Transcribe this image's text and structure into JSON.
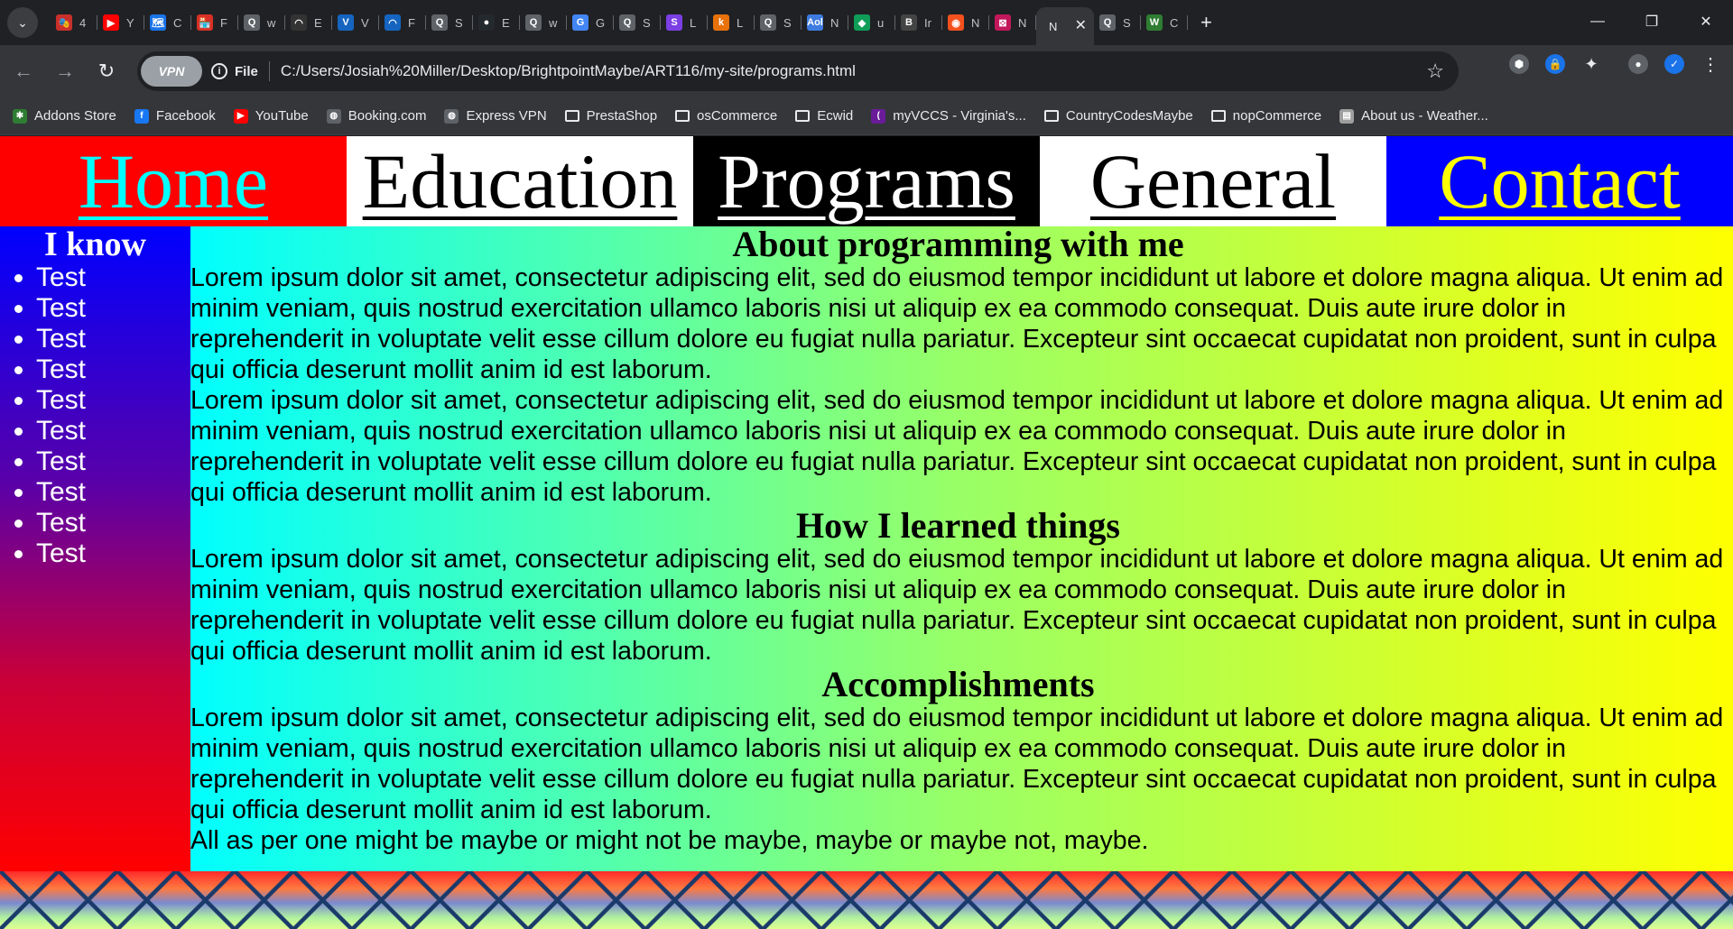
{
  "browser": {
    "tabs": [
      {
        "fav": "🎭",
        "title": "4",
        "color": "#c9302c"
      },
      {
        "fav": "▶",
        "title": "Y",
        "color": "#ff0000"
      },
      {
        "fav": "🗺",
        "title": "C",
        "color": "#1a73e8"
      },
      {
        "fav": "🏪",
        "title": "F",
        "color": "#d93025"
      },
      {
        "fav": "Q",
        "title": "w",
        "color": "#5f6368"
      },
      {
        "fav": "◠",
        "title": "E",
        "color": "#333333"
      },
      {
        "fav": "V",
        "title": "V",
        "color": "#1565c0"
      },
      {
        "fav": "◠",
        "title": "F",
        "color": "#1565c0"
      },
      {
        "fav": "Q",
        "title": "S",
        "color": "#5f6368"
      },
      {
        "fav": "●",
        "title": "E",
        "color": "#24292e"
      },
      {
        "fav": "Q",
        "title": "w",
        "color": "#5f6368"
      },
      {
        "fav": "G",
        "title": "G",
        "color": "#4285f4"
      },
      {
        "fav": "Q",
        "title": "S",
        "color": "#5f6368"
      },
      {
        "fav": "S",
        "title": "L",
        "color": "#7b3fe4"
      },
      {
        "fav": "k",
        "title": "L",
        "color": "#e8710a"
      },
      {
        "fav": "Q",
        "title": "S",
        "color": "#5f6368"
      },
      {
        "fav": "Aol",
        "title": "N",
        "color": "#3d7be0"
      },
      {
        "fav": "◆",
        "title": "u",
        "color": "#0f9d58"
      },
      {
        "fav": "B",
        "title": "Ir",
        "color": "#444444"
      },
      {
        "fav": "◉",
        "title": "N",
        "color": "#f4511e"
      },
      {
        "fav": "⊠",
        "title": "N",
        "color": "#c2185b"
      }
    ],
    "active_tab": {
      "title": "N",
      "close": "✕"
    },
    "after_tabs": [
      {
        "fav": "Q",
        "title": "S",
        "color": "#5f6368"
      },
      {
        "fav": "W",
        "title": "C",
        "color": "#2e7d32"
      }
    ],
    "new_tab": "+",
    "window_controls": {
      "minimize": "—",
      "restore": "❐",
      "close": "✕"
    },
    "nav": {
      "back": "←",
      "forward": "→",
      "reload": "↻"
    },
    "vpn_label": "VPN",
    "file_label": "File",
    "url": "C:/Users/Josiah%20Miller/Desktop/BrightpointMaybe/ART116/my-site/programs.html",
    "bookmarks": [
      {
        "label": "Addons Store",
        "icon": "puzzle",
        "color": "#2e7d32"
      },
      {
        "label": "Facebook",
        "icon": "f",
        "color": "#1877f2"
      },
      {
        "label": "YouTube",
        "icon": "▶",
        "color": "#ff0000"
      },
      {
        "label": "Booking.com",
        "icon": "globe",
        "color": "#5f6368"
      },
      {
        "label": "Express VPN",
        "icon": "globe",
        "color": "#5f6368"
      },
      {
        "label": "PrestaShop",
        "icon": "folder"
      },
      {
        "label": "osCommerce",
        "icon": "folder"
      },
      {
        "label": "Ecwid",
        "icon": "folder"
      },
      {
        "label": "myVCCS - Virginia's...",
        "icon": "(",
        "color": "#6a1b9a"
      },
      {
        "label": "CountryCodesMaybe",
        "icon": "folder"
      },
      {
        "label": "nopCommerce",
        "icon": "folder"
      },
      {
        "label": "About us - Weather...",
        "icon": "doc",
        "color": "#9e9e9e"
      }
    ]
  },
  "page": {
    "nav": {
      "home": "Home",
      "education": "Education",
      "programs": "Programs",
      "general": "General",
      "contact": "Contact"
    },
    "sidebar": {
      "heading": "I know",
      "items": [
        "Test",
        "Test",
        "Test",
        "Test",
        "Test",
        "Test",
        "Test",
        "Test",
        "Test",
        "Test"
      ]
    },
    "main": {
      "heading1": "About programming with me",
      "para1": "Lorem ipsum dolor sit amet, consectetur adipiscing elit, sed do eiusmod tempor incididunt ut labore et dolore magna aliqua. Ut enim ad minim veniam, quis nostrud exercitation ullamco laboris nisi ut aliquip ex ea commodo consequat. Duis aute irure dolor in reprehenderit in voluptate velit esse cillum dolore eu fugiat nulla pariatur. Excepteur sint occaecat cupidatat non proident, sunt in culpa qui officia deserunt mollit anim id est laborum.",
      "para2": "Lorem ipsum dolor sit amet, consectetur adipiscing elit, sed do eiusmod tempor incididunt ut labore et dolore magna aliqua. Ut enim ad minim veniam, quis nostrud exercitation ullamco laboris nisi ut aliquip ex ea commodo consequat. Duis aute irure dolor in reprehenderit in voluptate velit esse cillum dolore eu fugiat nulla pariatur. Excepteur sint occaecat cupidatat non proident, sunt in culpa qui officia deserunt mollit anim id est laborum.",
      "heading2": "How I learned things",
      "para3": "Lorem ipsum dolor sit amet, consectetur adipiscing elit, sed do eiusmod tempor incididunt ut labore et dolore magna aliqua. Ut enim ad minim veniam, quis nostrud exercitation ullamco laboris nisi ut aliquip ex ea commodo consequat. Duis aute irure dolor in reprehenderit in voluptate velit esse cillum dolore eu fugiat nulla pariatur. Excepteur sint occaecat cupidatat non proident, sunt in culpa qui officia deserunt mollit anim id est laborum.",
      "heading3": "Accomplishments",
      "para4": "Lorem ipsum dolor sit amet, consectetur adipiscing elit, sed do eiusmod tempor incididunt ut labore et dolore magna aliqua. Ut enim ad minim veniam, quis nostrud exercitation ullamco laboris nisi ut aliquip ex ea commodo consequat. Duis aute irure dolor in reprehenderit in voluptate velit esse cillum dolore eu fugiat nulla pariatur. Excepteur sint occaecat cupidatat non proident, sunt in culpa qui officia deserunt mollit anim id est laborum.",
      "closing": "All as per one might be maybe or might not be maybe, maybe or maybe not, maybe."
    }
  }
}
